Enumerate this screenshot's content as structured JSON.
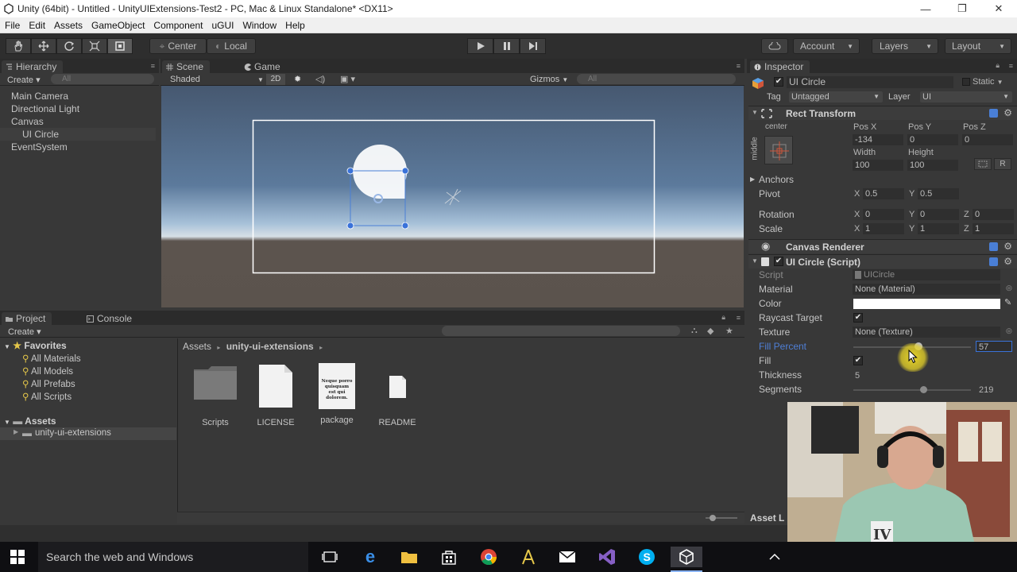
{
  "window": {
    "title": "Unity (64bit) - Untitled - UnityUIExtensions-Test2 - PC, Mac & Linux Standalone* <DX11>",
    "minimize": "—",
    "maximize": "❐",
    "close": "✕"
  },
  "menu": [
    "File",
    "Edit",
    "Assets",
    "GameObject",
    "Component",
    "uGUI",
    "Window",
    "Help"
  ],
  "toolbar": {
    "pivot_mode": "Center",
    "pivot_space": "Local",
    "account": "Account",
    "layers": "Layers",
    "layout": "Layout"
  },
  "hierarchy": {
    "tab": "Hierarchy",
    "create": "Create",
    "search_placeholder": "All",
    "items": [
      "Main Camera",
      "Directional Light",
      "Canvas",
      "UI Circle",
      "EventSystem"
    ]
  },
  "scene": {
    "tab_scene": "Scene",
    "tab_game": "Game",
    "shading": "Shaded",
    "mode_2d": "2D",
    "gizmos": "Gizmos",
    "search_placeholder": "All"
  },
  "inspector": {
    "tab": "Inspector",
    "object_name": "UI Circle",
    "static_label": "Static",
    "tag_label": "Tag",
    "tag_value": "Untagged",
    "layer_label": "Layer",
    "layer_value": "UI",
    "rect_transform": {
      "title": "Rect Transform",
      "anchor_h": "center",
      "anchor_v": "middle",
      "pos_x_label": "Pos X",
      "pos_y_label": "Pos Y",
      "pos_z_label": "Pos Z",
      "pos_x": "-134",
      "pos_y": "0",
      "pos_z": "0",
      "width_label": "Width",
      "height_label": "Height",
      "width": "100",
      "height": "100",
      "r_button": "R",
      "anchors_label": "Anchors",
      "pivot_label": "Pivot",
      "pivot_x": "0.5",
      "pivot_y": "0.5",
      "rotation_label": "Rotation",
      "rot_x": "0",
      "rot_y": "0",
      "rot_z": "0",
      "scale_label": "Scale",
      "scale_x": "1",
      "scale_y": "1",
      "scale_z": "1",
      "axis_x": "X",
      "axis_y": "Y",
      "axis_z": "Z"
    },
    "canvas_renderer": {
      "title": "Canvas Renderer"
    },
    "ui_circle": {
      "title": "UI Circle (Script)",
      "script_label": "Script",
      "script_value": "UICircle",
      "material_label": "Material",
      "material_value": "None (Material)",
      "color_label": "Color",
      "color_value": "#ffffff",
      "raycast_label": "Raycast Target",
      "texture_label": "Texture",
      "texture_value": "None (Texture)",
      "fill_percent_label": "Fill Percent",
      "fill_percent_value": "57",
      "fill_label": "Fill",
      "thickness_label": "Thickness",
      "thickness_value": "5",
      "segments_label": "Segments",
      "segments_value": "219"
    }
  },
  "project": {
    "tab_project": "Project",
    "tab_console": "Console",
    "create": "Create",
    "favorites_label": "Favorites",
    "favorites": [
      "All Materials",
      "All Models",
      "All Prefabs",
      "All Scripts"
    ],
    "assets_label": "Assets",
    "folders": [
      "unity-ui-extensions"
    ],
    "breadcrumb_root": "Assets",
    "breadcrumb_folder": "unity-ui-extensions",
    "assets": [
      {
        "name": "Scripts",
        "icon": "folder-icon"
      },
      {
        "name": "LICENSE",
        "icon": "file-icon"
      },
      {
        "name": "package",
        "icon": "document-icon"
      },
      {
        "name": "README",
        "icon": "file-icon"
      }
    ],
    "package_preview": "Neque porro quisquam est qui dolorem."
  },
  "asset_label_partial": "Asset L",
  "taskbar": {
    "search_placeholder": "Search the web and Windows"
  },
  "colors": {
    "accent_blue": "#3a72d9",
    "fill_percent_label": "#4f7fd6",
    "selection": "#3e3e3e"
  }
}
